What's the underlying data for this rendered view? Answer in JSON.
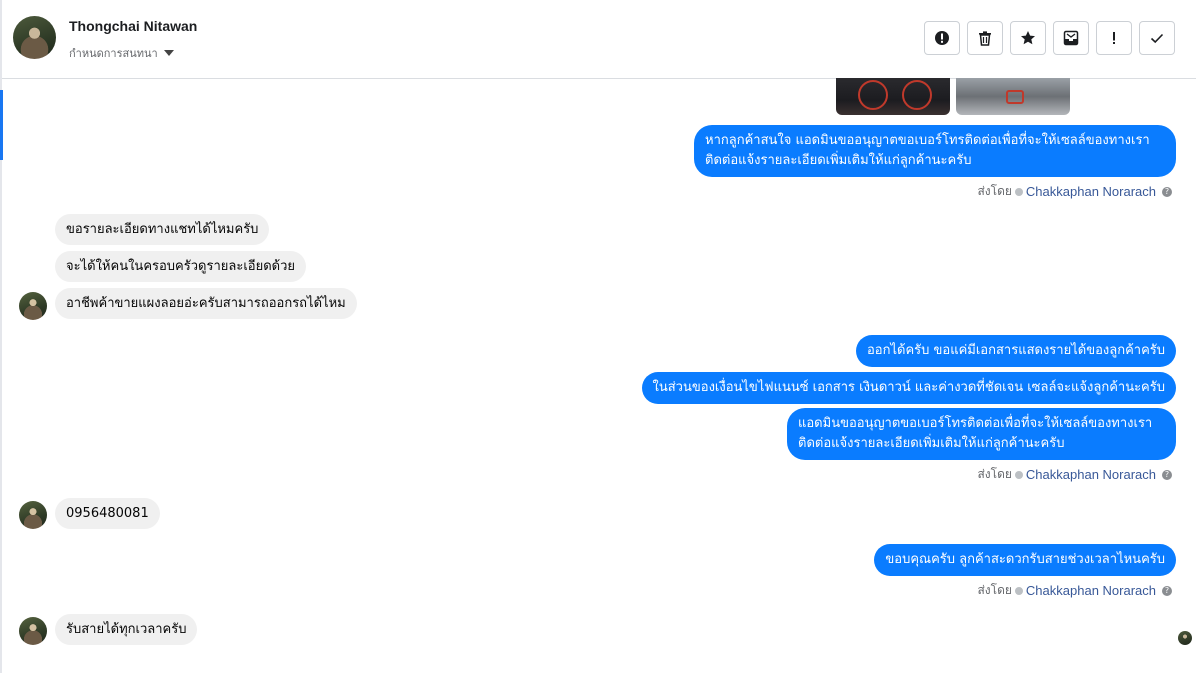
{
  "header": {
    "contact_name": "Thongchai Nitawan",
    "conversation_menu_label": "กำหนดการสนทนา"
  },
  "toolbar": {
    "buttons": [
      "report-spam",
      "delete",
      "star",
      "mark-unread",
      "mark-important",
      "mark-done"
    ]
  },
  "messages": {
    "out_1": "หากลูกค้าสนใจ แอดมินขออนุญาตขอเบอร์โทรติดต่อเพื่อที่จะให้เซลล์ของทางเราติดต่อแจ้งรายละเอียดเพิ่มเติมให้แก่ลูกค้านะครับ",
    "out_1_line1": "หากลูกค้าสนใจ แอดมินขออนุญาตขอเบอร์โทรติดต่อเพื่อที่จะให้เซลล์ของทางเรา",
    "out_1_line2": "ติดต่อแจ้งรายละเอียดเพิ่มเติมให้แก่ลูกค้านะครับ",
    "in_1": "ขอรายละเอียดทางแชทได้ไหมครับ",
    "in_2": "จะได้ให้คนในครอบครัวดูรายละเอียดด้วย",
    "in_3": "อาชีพค้าขายแผงลอยอ่ะครับสามารถออกรถได้ไหม",
    "out_2": "ออกได้ครับ ขอแค่มีเอกสารแสดงรายได้ของลูกค้าครับ",
    "out_3": "ในส่วนของเงื่อนไขไฟแนนซ์ เอกสาร เงินดาวน์ และค่างวดที่ชัดเจน เซลล์จะแจ้งลูกค้านะครับ",
    "out_4_line1": "แอดมินขออนุญาตขอเบอร์โทรติดต่อเพื่อที่จะให้เซลล์ของทางเรา",
    "out_4_line2": "ติดต่อแจ้งรายละเอียดเพิ่มเติมให้แก่ลูกค้านะครับ",
    "in_4": "0956480081",
    "out_5": "ขอบคุณครับ ลูกค้าสะดวกรับสายช่วงเวลาไหนครับ",
    "in_5": "รับสายได้ทุกเวลาครับ"
  },
  "sent_by": {
    "prefix": "ส่งโดย",
    "sender": "Chakkaphan Norarach"
  },
  "colors": {
    "outgoing_bubble": "#0a7cff",
    "incoming_bubble": "#f0f0f0",
    "accent": "#1877f2",
    "sender_link": "#385898"
  }
}
